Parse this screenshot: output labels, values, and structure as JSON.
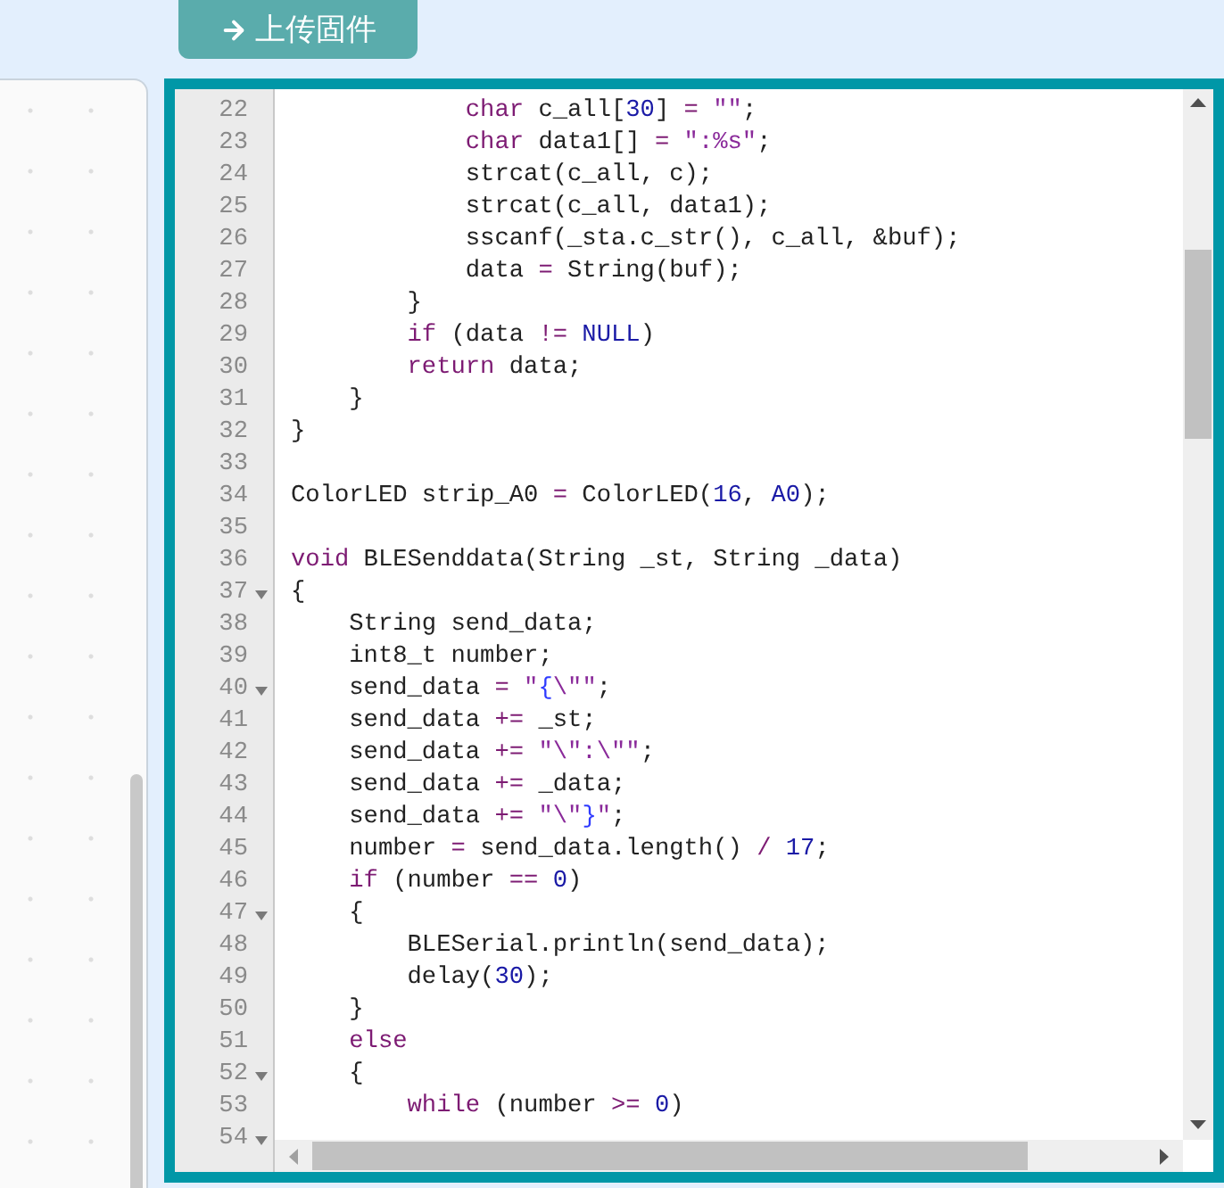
{
  "upload_button": {
    "label": "上传固件"
  },
  "editor": {
    "lines": [
      {
        "number": "22",
        "foldable": false,
        "tokens": [
          {
            "kind": "kw",
            "text": "            char"
          },
          {
            "kind": "plain",
            "text": " c_all["
          },
          {
            "kind": "num",
            "text": "30"
          },
          {
            "kind": "plain",
            "text": "] "
          },
          {
            "kind": "op",
            "text": "= "
          },
          {
            "kind": "str",
            "text": "\"\""
          },
          {
            "kind": "plain",
            "text": ";"
          }
        ]
      },
      {
        "number": "23",
        "foldable": false,
        "tokens": [
          {
            "kind": "kw",
            "text": "            char"
          },
          {
            "kind": "plain",
            "text": " data1[] "
          },
          {
            "kind": "op",
            "text": "= "
          },
          {
            "kind": "str",
            "text": "\":%s\""
          },
          {
            "kind": "plain",
            "text": ";"
          }
        ]
      },
      {
        "number": "24",
        "foldable": false,
        "tokens": [
          {
            "kind": "plain",
            "text": "            strcat(c_all, c);"
          }
        ]
      },
      {
        "number": "25",
        "foldable": false,
        "tokens": [
          {
            "kind": "plain",
            "text": "            strcat(c_all, data1);"
          }
        ]
      },
      {
        "number": "26",
        "foldable": false,
        "tokens": [
          {
            "kind": "plain",
            "text": "            sscanf(_sta.c_str(), c_all, &buf);"
          }
        ]
      },
      {
        "number": "27",
        "foldable": false,
        "tokens": [
          {
            "kind": "plain",
            "text": "            data "
          },
          {
            "kind": "op",
            "text": "="
          },
          {
            "kind": "plain",
            "text": " String(buf);"
          }
        ]
      },
      {
        "number": "28",
        "foldable": false,
        "tokens": [
          {
            "kind": "plain",
            "text": "        }"
          }
        ]
      },
      {
        "number": "29",
        "foldable": false,
        "tokens": [
          {
            "kind": "kw",
            "text": "        if"
          },
          {
            "kind": "plain",
            "text": " (data "
          },
          {
            "kind": "op",
            "text": "!= "
          },
          {
            "kind": "num",
            "text": "NULL"
          },
          {
            "kind": "plain",
            "text": ")"
          }
        ]
      },
      {
        "number": "30",
        "foldable": false,
        "tokens": [
          {
            "kind": "kw",
            "text": "        return"
          },
          {
            "kind": "plain",
            "text": " data;"
          }
        ]
      },
      {
        "number": "31",
        "foldable": false,
        "tokens": [
          {
            "kind": "plain",
            "text": "    }"
          }
        ]
      },
      {
        "number": "32",
        "foldable": false,
        "tokens": [
          {
            "kind": "plain",
            "text": "}"
          }
        ]
      },
      {
        "number": "33",
        "foldable": false
      },
      {
        "number": "34",
        "foldable": false,
        "tokens": [
          {
            "kind": "plain",
            "text": "ColorLED strip_A0 "
          },
          {
            "kind": "op",
            "text": "="
          },
          {
            "kind": "plain",
            "text": " ColorLED("
          },
          {
            "kind": "num",
            "text": "16"
          },
          {
            "kind": "plain",
            "text": ", "
          },
          {
            "kind": "num",
            "text": "A0"
          },
          {
            "kind": "plain",
            "text": ");"
          }
        ]
      },
      {
        "number": "35",
        "foldable": false
      },
      {
        "number": "36",
        "foldable": false,
        "tokens": [
          {
            "kind": "kw",
            "text": "void"
          },
          {
            "kind": "plain",
            "text": " BLESenddata(String _st, String _data)"
          }
        ]
      },
      {
        "number": "37",
        "foldable": true,
        "tokens": [
          {
            "kind": "plain",
            "text": "{"
          }
        ]
      },
      {
        "number": "38",
        "foldable": false,
        "tokens": [
          {
            "kind": "plain",
            "text": "    String send_data;"
          }
        ]
      },
      {
        "number": "39",
        "foldable": false,
        "tokens": [
          {
            "kind": "plain",
            "text": "    int8_t number;"
          }
        ]
      },
      {
        "number": "40",
        "foldable": true,
        "tokens": [
          {
            "kind": "plain",
            "text": "    send_data "
          },
          {
            "kind": "op",
            "text": "= "
          },
          {
            "kind": "str",
            "text": "\""
          },
          {
            "kind": "esc",
            "text": "{"
          },
          {
            "kind": "str",
            "text": "\\\"\""
          },
          {
            "kind": "plain",
            "text": ";"
          }
        ]
      },
      {
        "number": "41",
        "foldable": false,
        "tokens": [
          {
            "kind": "plain",
            "text": "    send_data "
          },
          {
            "kind": "op",
            "text": "+="
          },
          {
            "kind": "plain",
            "text": " _st;"
          }
        ]
      },
      {
        "number": "42",
        "foldable": false,
        "tokens": [
          {
            "kind": "plain",
            "text": "    send_data "
          },
          {
            "kind": "op",
            "text": "+= "
          },
          {
            "kind": "str",
            "text": "\"\\\":\\\"\""
          },
          {
            "kind": "plain",
            "text": ";"
          }
        ]
      },
      {
        "number": "43",
        "foldable": false,
        "tokens": [
          {
            "kind": "plain",
            "text": "    send_data "
          },
          {
            "kind": "op",
            "text": "+="
          },
          {
            "kind": "plain",
            "text": " _data;"
          }
        ]
      },
      {
        "number": "44",
        "foldable": false,
        "tokens": [
          {
            "kind": "plain",
            "text": "    send_data "
          },
          {
            "kind": "op",
            "text": "+= "
          },
          {
            "kind": "str",
            "text": "\"\\\""
          },
          {
            "kind": "esc",
            "text": "}"
          },
          {
            "kind": "str",
            "text": "\""
          },
          {
            "kind": "plain",
            "text": ";"
          }
        ]
      },
      {
        "number": "45",
        "foldable": false,
        "tokens": [
          {
            "kind": "plain",
            "text": "    number "
          },
          {
            "kind": "op",
            "text": "="
          },
          {
            "kind": "plain",
            "text": " send_data.length() "
          },
          {
            "kind": "op",
            "text": "/ "
          },
          {
            "kind": "num",
            "text": "17"
          },
          {
            "kind": "plain",
            "text": ";"
          }
        ]
      },
      {
        "number": "46",
        "foldable": false,
        "tokens": [
          {
            "kind": "kw",
            "text": "    if"
          },
          {
            "kind": "plain",
            "text": " (number "
          },
          {
            "kind": "op",
            "text": "== "
          },
          {
            "kind": "num",
            "text": "0"
          },
          {
            "kind": "plain",
            "text": ")"
          }
        ]
      },
      {
        "number": "47",
        "foldable": true,
        "tokens": [
          {
            "kind": "plain",
            "text": "    {"
          }
        ]
      },
      {
        "number": "48",
        "foldable": false,
        "tokens": [
          {
            "kind": "plain",
            "text": "        BLESerial.println(send_data);"
          }
        ]
      },
      {
        "number": "49",
        "foldable": false,
        "tokens": [
          {
            "kind": "plain",
            "text": "        delay("
          },
          {
            "kind": "num",
            "text": "30"
          },
          {
            "kind": "plain",
            "text": ");"
          }
        ]
      },
      {
        "number": "50",
        "foldable": false,
        "tokens": [
          {
            "kind": "plain",
            "text": "    }"
          }
        ]
      },
      {
        "number": "51",
        "foldable": false,
        "tokens": [
          {
            "kind": "kw",
            "text": "    else"
          }
        ]
      },
      {
        "number": "52",
        "foldable": true,
        "tokens": [
          {
            "kind": "plain",
            "text": "    {"
          }
        ]
      },
      {
        "number": "53",
        "foldable": false,
        "tokens": [
          {
            "kind": "kw",
            "text": "        while"
          },
          {
            "kind": "plain",
            "text": " (number "
          },
          {
            "kind": "op",
            "text": ">= "
          },
          {
            "kind": "num",
            "text": "0"
          },
          {
            "kind": "plain",
            "text": ")"
          }
        ]
      },
      {
        "number": "54",
        "foldable": true
      }
    ]
  }
}
